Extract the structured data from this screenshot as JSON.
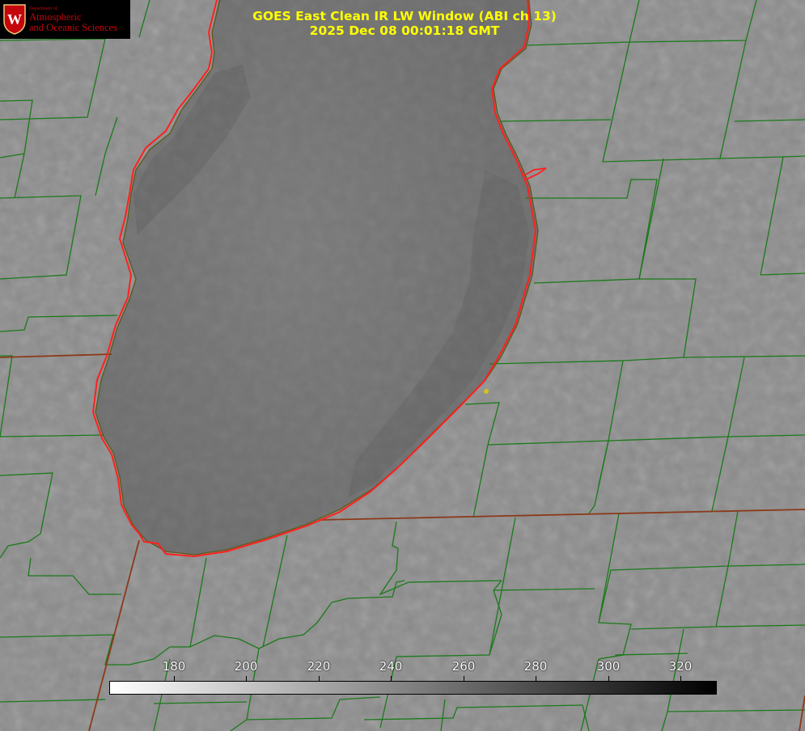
{
  "title": {
    "line1": "GOES East Clean IR LW Window (ABI ch 13)",
    "line2": "2025 Dec 08 00:01:18 GMT"
  },
  "logo": {
    "department": "Department of",
    "line1": "Atmospheric",
    "line2": "and Oceanic Sciences",
    "seal_letter": "W"
  },
  "colorbar": {
    "tick_labels": [
      "180",
      "200",
      "220",
      "240",
      "260",
      "280",
      "300",
      "320"
    ],
    "color_low": "#ffffff",
    "color_high": "#000000"
  },
  "colors": {
    "title": "#ffff00",
    "county_lines": "#1a7a1a",
    "state_lines": "#8b3a1a",
    "coastline": "#ff2020",
    "station_dot": "#d4c020",
    "logo_red": "#c5050c"
  }
}
